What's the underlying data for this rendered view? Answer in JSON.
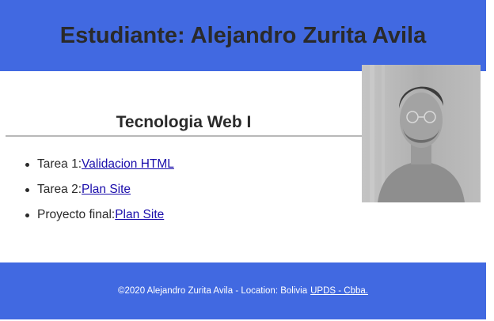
{
  "header": {
    "title": "Estudiante: Alejandro Zurita Avila"
  },
  "colors": {
    "banner": "#4169e1",
    "text": "#2a2a2a",
    "link": "#1a0dab",
    "footer_text": "#ffffff"
  },
  "main": {
    "section_title": "Tecnologia Web I",
    "tasks": [
      {
        "prefix": "Tarea 1:",
        "link": "Validacion HTML"
      },
      {
        "prefix": "Tarea 2:",
        "link": "Plan Site"
      },
      {
        "prefix": "Proyecto final:",
        "link": "Plan Site"
      }
    ]
  },
  "photo": {
    "icon": "profile-photo"
  },
  "footer": {
    "text": "©2020 Alejandro Zurita Avila - Location: Bolivia",
    "link": "UPDS - Cbba."
  }
}
